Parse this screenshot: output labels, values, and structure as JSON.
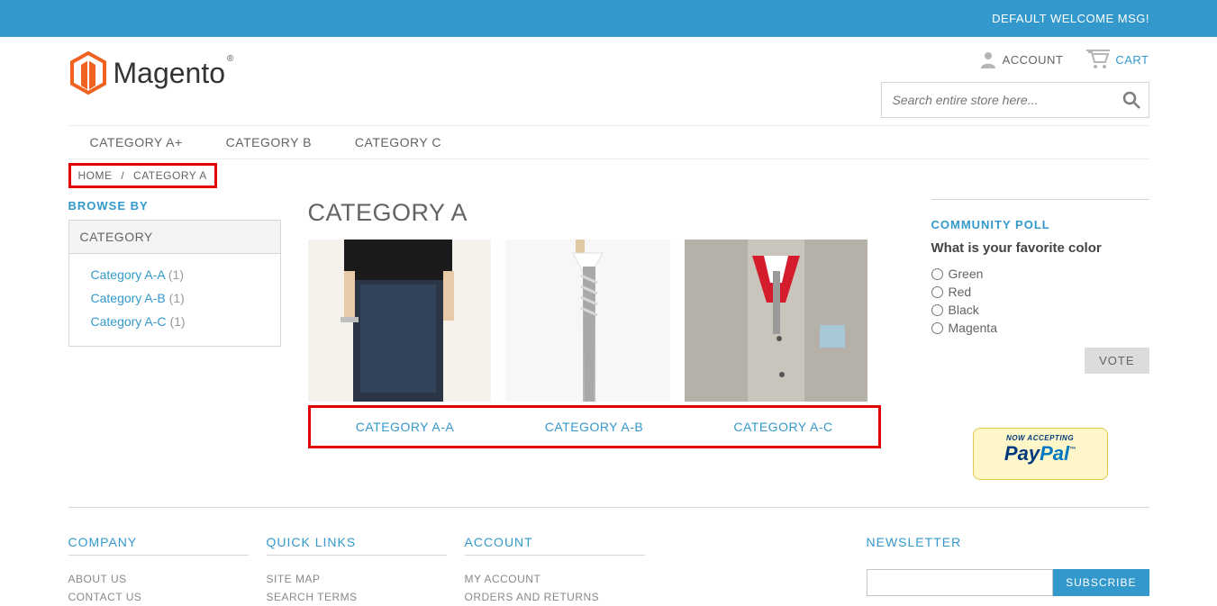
{
  "top_bar": {
    "welcome": "DEFAULT WELCOME MSG!"
  },
  "header": {
    "logo_text": "Magento",
    "account_label": "ACCOUNT",
    "cart_label": "CART",
    "search_placeholder": "Search entire store here..."
  },
  "nav": [
    "CATEGORY A+",
    "CATEGORY B",
    "CATEGORY C"
  ],
  "breadcrumb": {
    "home": "HOME",
    "current": "CATEGORY A",
    "sep": "/"
  },
  "sidebar": {
    "browse_title": "BROWSE BY",
    "filter_head": "CATEGORY",
    "items": [
      {
        "label": "Category A-A",
        "count": "(1)"
      },
      {
        "label": "Category A-B",
        "count": "(1)"
      },
      {
        "label": "Category A-C",
        "count": "(1)"
      }
    ]
  },
  "page": {
    "title": "CATEGORY A",
    "subs": [
      "CATEGORY A-A",
      "CATEGORY A-B",
      "CATEGORY A-C"
    ]
  },
  "poll": {
    "title": "COMMUNITY POLL",
    "question": "What is your favorite color",
    "options": [
      "Green",
      "Red",
      "Black",
      "Magenta"
    ],
    "vote_label": "VOTE"
  },
  "paypal": {
    "line1": "NOW ACCEPTING",
    "pay": "Pay",
    "pal": "Pal"
  },
  "footer": {
    "company": {
      "title": "COMPANY",
      "links": [
        "ABOUT US",
        "CONTACT US"
      ]
    },
    "quick": {
      "title": "QUICK LINKS",
      "links": [
        "SITE MAP",
        "SEARCH TERMS"
      ]
    },
    "account": {
      "title": "ACCOUNT",
      "links": [
        "MY ACCOUNT",
        "ORDERS AND RETURNS"
      ]
    },
    "newsletter": {
      "title": "NEWSLETTER",
      "subscribe": "SUBSCRIBE"
    }
  }
}
